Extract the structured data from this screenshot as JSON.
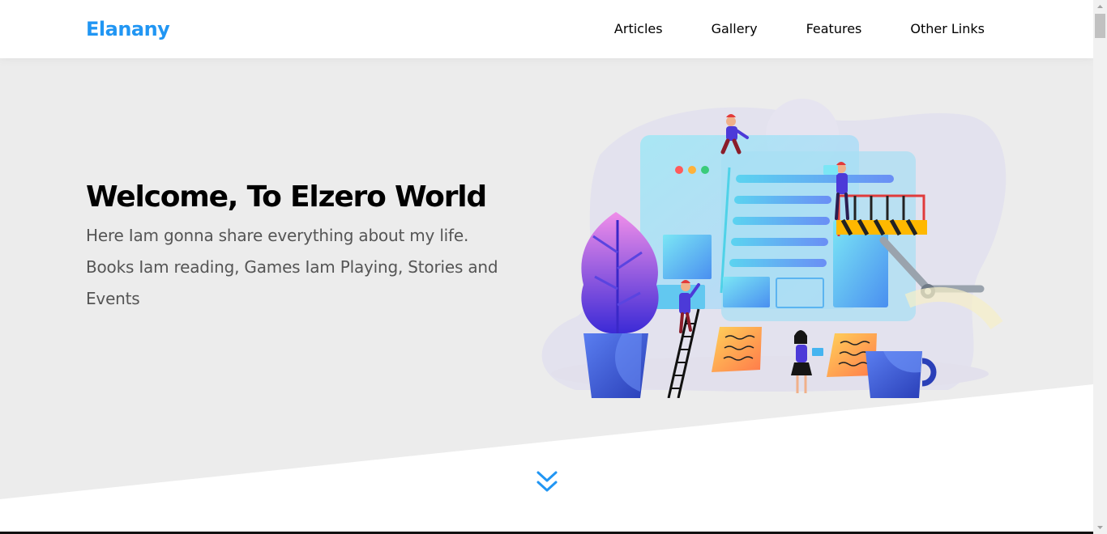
{
  "header": {
    "logo": "Elanany",
    "nav": [
      {
        "label": "Articles"
      },
      {
        "label": "Gallery"
      },
      {
        "label": "Features"
      },
      {
        "label": "Other Links"
      }
    ]
  },
  "landing": {
    "title": "Welcome, To Elzero World",
    "description": "Here Iam gonna share everything about my life. Books Iam reading, Games Iam Playing, Stories and Events"
  },
  "colors": {
    "brand": "#2196f3",
    "landing_bg": "#ececec"
  },
  "icons": {
    "scroll_down": "chevrons-down-icon"
  }
}
